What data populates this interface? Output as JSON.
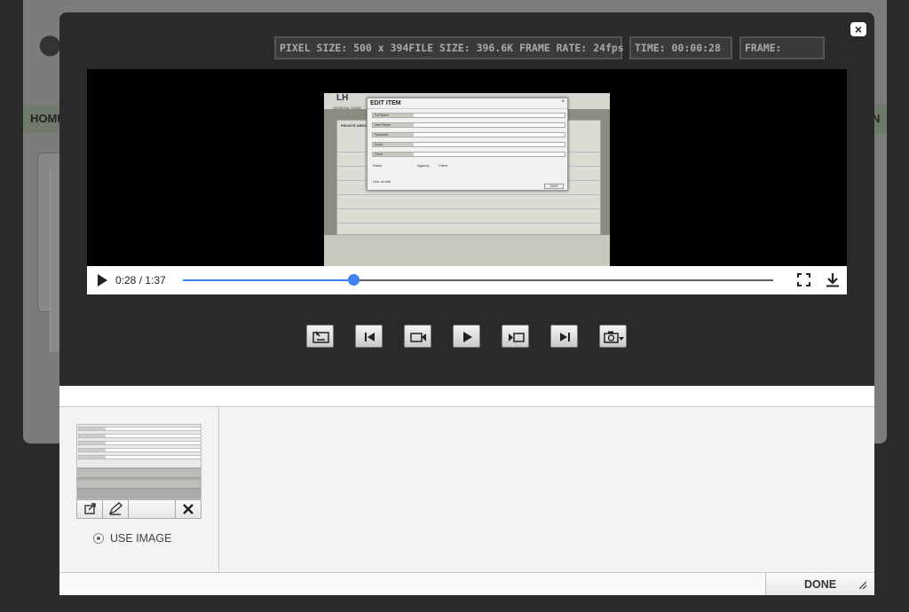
{
  "background": {
    "nav_home": "HOME",
    "nav_right": "N"
  },
  "modal": {
    "close_label": "×",
    "info": {
      "pixel_size": "PIXEL SIZE: 500 x 394",
      "file_size": "FILE SIZE: 396.6K",
      "frame_rate": "FRAME RATE: 24fps",
      "time": "TIME: 00:00:28",
      "frame": "FRAME:"
    },
    "video_frame": {
      "dialog_title": "EDIT ITEM",
      "dialog_close": "×",
      "fields": [
        "Full Name",
        "User Name",
        "Password",
        "Email",
        "Client"
      ],
      "roles_label": "Roles",
      "role_options": [
        "Agency",
        "Client"
      ],
      "live_label": "Live on site",
      "save_label": "SAVE",
      "bg_logo": "LH",
      "bg_tabs": "GENERAL   HOME",
      "bg_heading": "PRIVATE AREA"
    },
    "player": {
      "time_display": "0:28 / 1:37",
      "progress": 0.289
    },
    "toolbar": {
      "icons": [
        "set-poster-icon",
        "first-frame-icon",
        "record-icon",
        "play-icon",
        "step-frame-icon",
        "last-frame-icon",
        "camera-menu-icon"
      ]
    },
    "use_image_label": "USE IMAGE",
    "done_label": "DONE",
    "colors": {
      "accent": "#3f82f1",
      "modal_bg": "#2a2a2a"
    }
  }
}
